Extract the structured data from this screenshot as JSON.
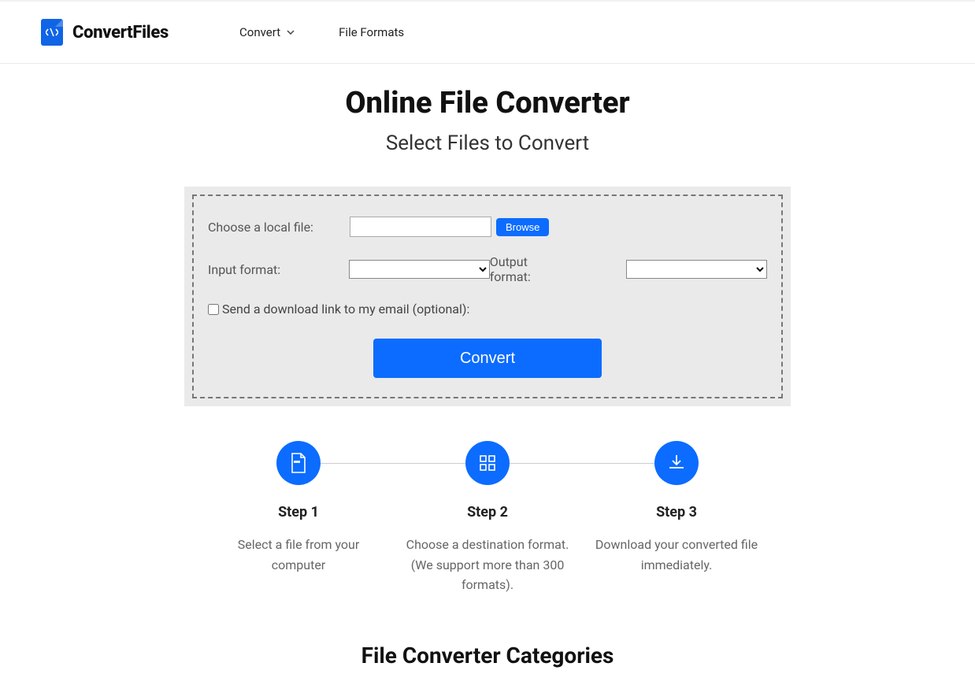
{
  "brand": "ConvertFiles",
  "nav": {
    "convert": "Convert",
    "file_formats": "File Formats"
  },
  "page": {
    "title": "Online File Converter",
    "subtitle": "Select Files to Convert"
  },
  "form": {
    "choose_file_label": "Choose a local file:",
    "browse": "Browse",
    "input_format_label": "Input format:",
    "output_format_label": "Output format:",
    "email_label": "Send a download link to my email (optional):",
    "convert": "Convert"
  },
  "steps": [
    {
      "title": "Step 1",
      "desc": "Select a file from your computer"
    },
    {
      "title": "Step 2",
      "desc": "Choose a destination format. (We support more than 300 formats)."
    },
    {
      "title": "Step 3",
      "desc": "Download your converted file immediately."
    }
  ],
  "categories_title": "File Converter Categories"
}
